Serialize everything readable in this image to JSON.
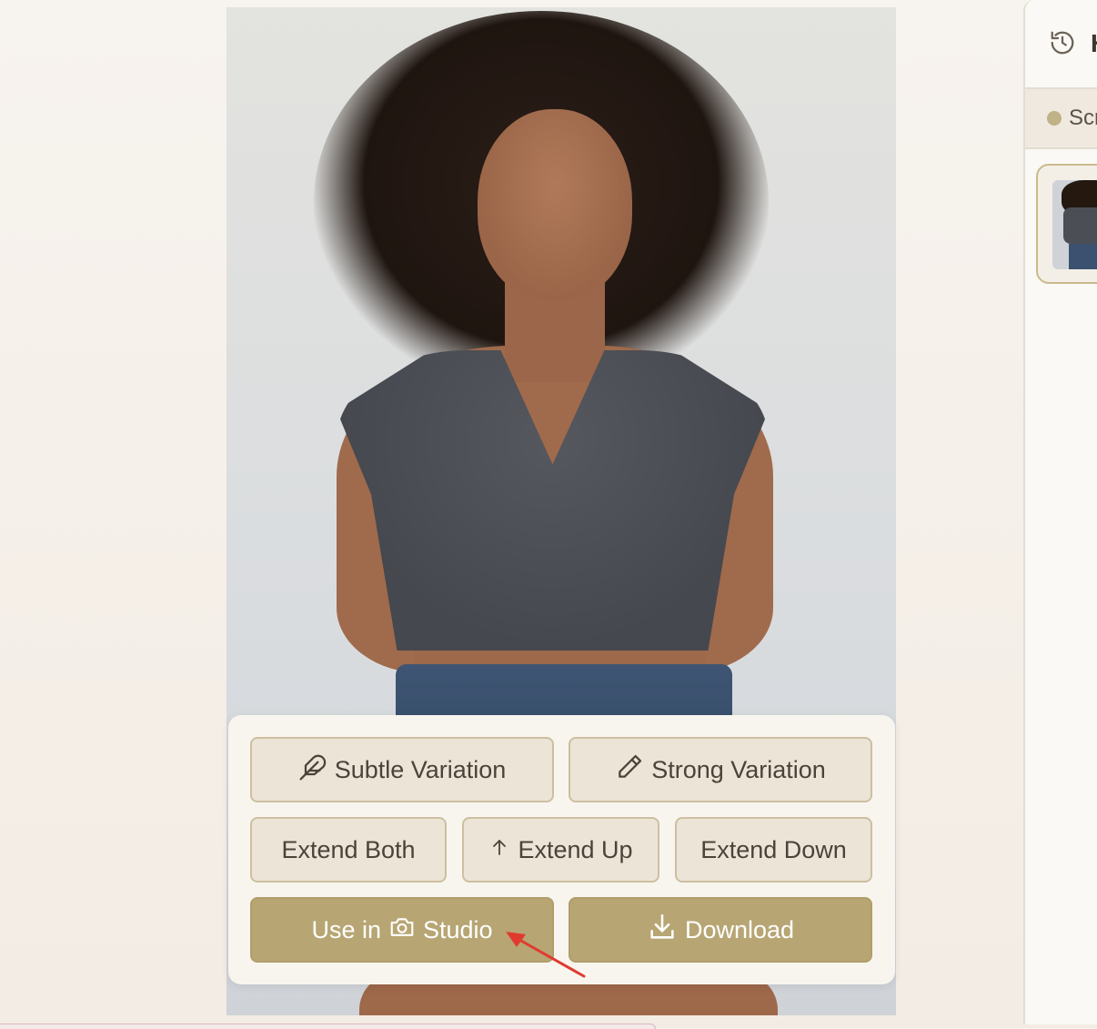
{
  "actions": {
    "subtle_variation": "Subtle Variation",
    "strong_variation": "Strong Variation",
    "extend_both": "Extend Both",
    "extend_up": "Extend Up",
    "extend_down": "Extend Down",
    "use_in_prefix": "Use in",
    "use_in_suffix": "Studio",
    "download": "Download"
  },
  "icons": {
    "subtle": "feather-icon",
    "strong": "pencil-icon",
    "up": "arrow-up-icon",
    "camera": "camera-icon",
    "download": "download-icon",
    "history": "history-icon"
  },
  "sidebar": {
    "title": "H",
    "tab_label": "Scr"
  },
  "colors": {
    "accent": "#b7a674",
    "button_light": "#ece4d7",
    "button_border": "#cdbf9f",
    "annotation_arrow": "#e03a2f"
  }
}
